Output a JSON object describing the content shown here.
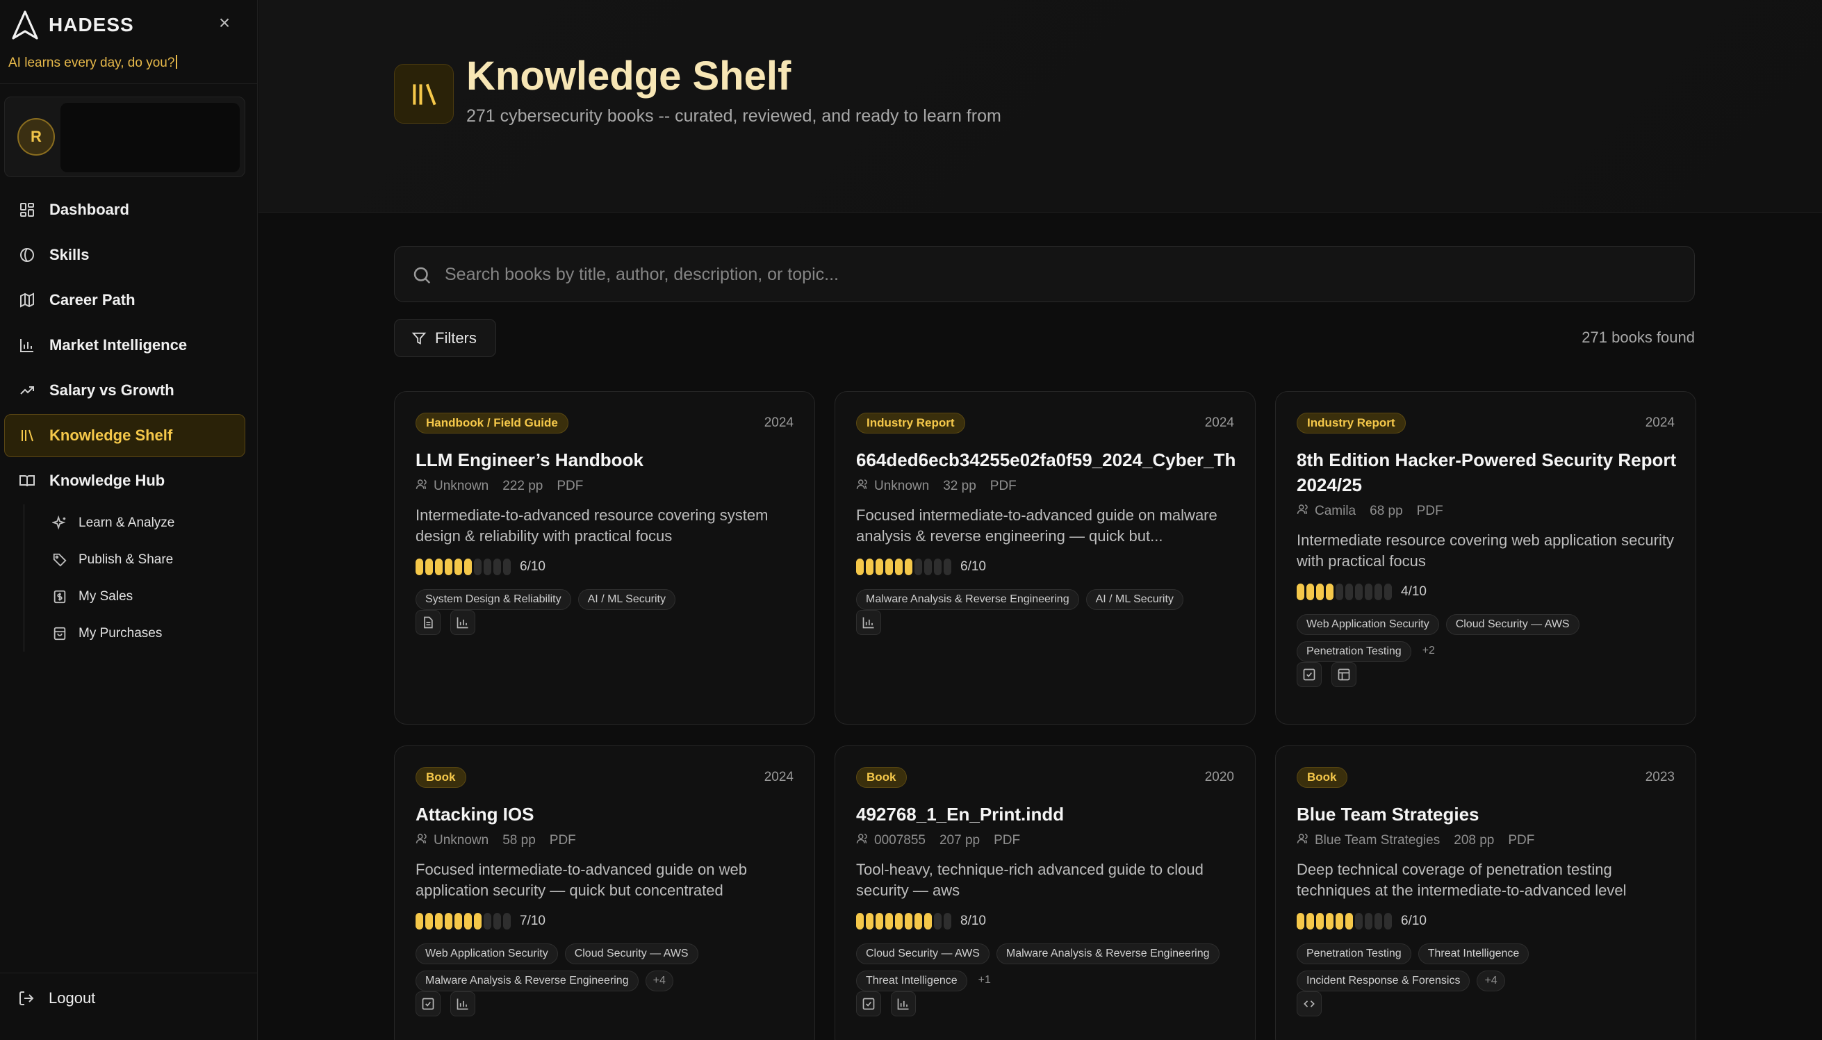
{
  "sidebar": {
    "brand": "HADESS",
    "tagline": "AI learns every day, do you?",
    "avatar_initial": "R",
    "nav": [
      {
        "label": "Dashboard",
        "icon": "dashboard-icon"
      },
      {
        "label": "Skills",
        "icon": "skills-icon"
      },
      {
        "label": "Career Path",
        "icon": "map-icon"
      },
      {
        "label": "Market Intelligence",
        "icon": "bar-chart-icon"
      },
      {
        "label": "Salary vs Growth",
        "icon": "trend-icon"
      },
      {
        "label": "Knowledge Shelf",
        "icon": "library-icon",
        "active": true
      },
      {
        "label": "Knowledge Hub",
        "icon": "book-open-icon"
      }
    ],
    "subnav": [
      {
        "label": "Learn & Analyze",
        "icon": "sparkle-icon"
      },
      {
        "label": "Publish & Share",
        "icon": "tag-icon"
      },
      {
        "label": "My Sales",
        "icon": "dollar-icon"
      },
      {
        "label": "My Purchases",
        "icon": "bag-icon"
      }
    ],
    "logout": "Logout"
  },
  "header": {
    "title": "Knowledge Shelf",
    "subtitle": "271 cybersecurity books -- curated, reviewed, and ready to learn from"
  },
  "search": {
    "placeholder": "Search books by title, author, description, or topic..."
  },
  "filters_label": "Filters",
  "results_count": "271 books found",
  "accent": "#f5c84a",
  "books": [
    {
      "category": "Handbook / Field Guide",
      "year": "2024",
      "title": "LLM Engineer’s Handbook",
      "author": "Unknown",
      "pages": "222 pp",
      "format": "PDF",
      "description": "Intermediate-to-advanced resource covering system design & reliability with practical focus",
      "rating": 6,
      "score": "6/10",
      "tags": [
        "System Design & Reliability",
        "AI / ML Security"
      ],
      "more": ""
    },
    {
      "category": "Industry Report",
      "year": "2024",
      "title": "664ded6ecb34255e02fa0f59_2024_Cyber_Th",
      "author": "Unknown",
      "pages": "32 pp",
      "format": "PDF",
      "description": "Focused intermediate-to-advanced guide on malware analysis & reverse engineering — quick but...",
      "rating": 6,
      "score": "6/10",
      "tags": [
        "Malware Analysis & Reverse Engineering",
        "AI / ML Security"
      ],
      "more": ""
    },
    {
      "category": "Industry Report",
      "year": "2024",
      "title": "8th Edition Hacker-Powered Security Report 2024/25",
      "author": "Camila",
      "pages": "68 pp",
      "format": "PDF",
      "description": "Intermediate resource covering web application security with practical focus",
      "rating": 4,
      "score": "4/10",
      "tags": [
        "Web Application Security",
        "Cloud Security — AWS",
        "Penetration Testing"
      ],
      "more": "+2"
    },
    {
      "category": "Book",
      "year": "2024",
      "title": "Attacking IOS",
      "author": "Unknown",
      "pages": "58 pp",
      "format": "PDF",
      "description": "Focused intermediate-to-advanced guide on web application security — quick but concentrated",
      "rating": 7,
      "score": "7/10",
      "tags": [
        "Web Application Security",
        "Cloud Security — AWS",
        "Malware Analysis & Reverse Engineering"
      ],
      "more": "+4"
    },
    {
      "category": "Book",
      "year": "2020",
      "title": "492768_1_En_Print.indd",
      "author": "0007855",
      "pages": "207 pp",
      "format": "PDF",
      "description": "Tool-heavy, technique-rich advanced guide to cloud security — aws",
      "rating": 8,
      "score": "8/10",
      "tags": [
        "Cloud Security — AWS",
        "Malware Analysis & Reverse Engineering",
        "Threat Intelligence"
      ],
      "more": "+1"
    },
    {
      "category": "Book",
      "year": "2023",
      "title": "Blue Team Strategies",
      "author": "Blue Team Strategies",
      "pages": "208 pp",
      "format": "PDF",
      "description": "Deep technical coverage of penetration testing techniques at the intermediate-to-advanced level",
      "rating": 6,
      "score": "6/10",
      "tags": [
        "Penetration Testing",
        "Threat Intelligence",
        "Incident Response & Forensics"
      ],
      "more": "+4"
    }
  ]
}
